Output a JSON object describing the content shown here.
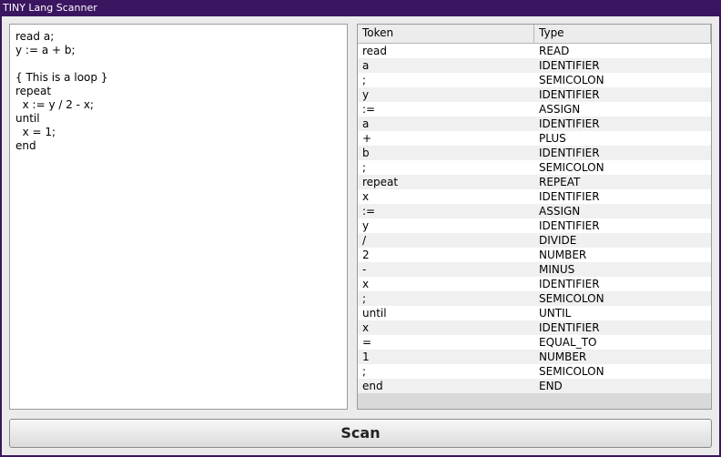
{
  "window": {
    "title": "TINY Lang Scanner"
  },
  "editor": {
    "source": "read a;\ny := a + b;\n\n{ This is a loop }\nrepeat\n  x := y / 2 - x;\nuntil\n  x = 1;\nend"
  },
  "table": {
    "headers": {
      "token": "Token",
      "type": "Type"
    },
    "rows": [
      {
        "token": "read",
        "type": "READ"
      },
      {
        "token": "a",
        "type": "IDENTIFIER"
      },
      {
        "token": ";",
        "type": "SEMICOLON"
      },
      {
        "token": "y",
        "type": "IDENTIFIER"
      },
      {
        "token": ":=",
        "type": "ASSIGN"
      },
      {
        "token": "a",
        "type": "IDENTIFIER"
      },
      {
        "token": "+",
        "type": "PLUS"
      },
      {
        "token": "b",
        "type": "IDENTIFIER"
      },
      {
        "token": ";",
        "type": "SEMICOLON"
      },
      {
        "token": "repeat",
        "type": "REPEAT"
      },
      {
        "token": "x",
        "type": "IDENTIFIER"
      },
      {
        "token": ":=",
        "type": "ASSIGN"
      },
      {
        "token": "y",
        "type": "IDENTIFIER"
      },
      {
        "token": "/",
        "type": "DIVIDE"
      },
      {
        "token": "2",
        "type": "NUMBER"
      },
      {
        "token": "-",
        "type": "MINUS"
      },
      {
        "token": "x",
        "type": "IDENTIFIER"
      },
      {
        "token": ";",
        "type": "SEMICOLON"
      },
      {
        "token": "until",
        "type": "UNTIL"
      },
      {
        "token": "x",
        "type": "IDENTIFIER"
      },
      {
        "token": "=",
        "type": "EQUAL_TO"
      },
      {
        "token": "1",
        "type": "NUMBER"
      },
      {
        "token": ";",
        "type": "SEMICOLON"
      },
      {
        "token": "end",
        "type": "END"
      }
    ]
  },
  "actions": {
    "scan_label": "Scan"
  },
  "colors": {
    "titlebar": "#3b1660",
    "background": "#ebebeb"
  }
}
